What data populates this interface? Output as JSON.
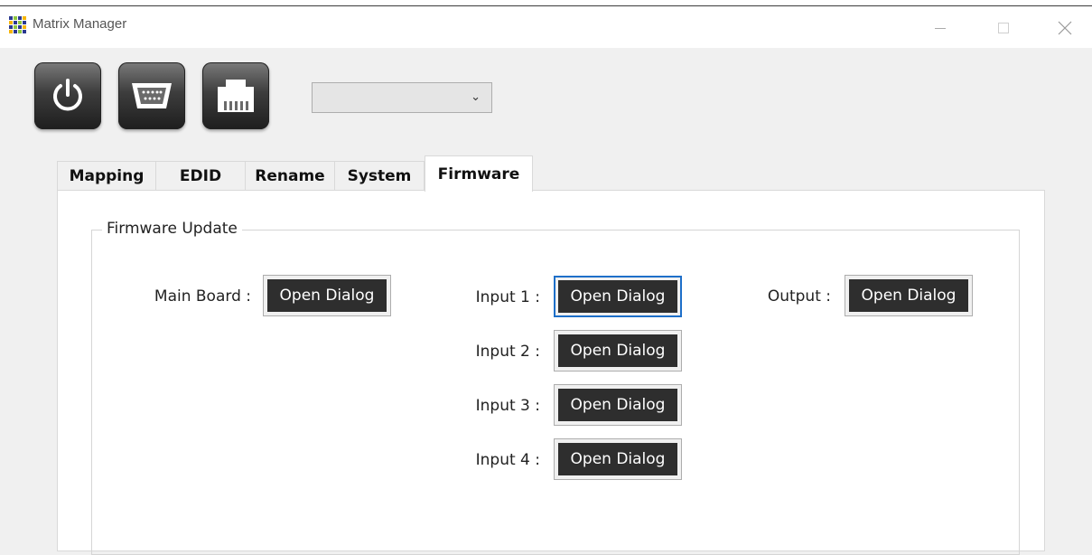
{
  "window": {
    "title": "Matrix Manager",
    "controls": [
      "minimize",
      "maximize",
      "close"
    ]
  },
  "toolbar": {
    "buttons": [
      {
        "icon": "power-icon"
      },
      {
        "icon": "serial-port-icon"
      },
      {
        "icon": "ethernet-port-icon"
      }
    ],
    "port_select": {
      "value": ""
    }
  },
  "tabs": [
    "Mapping",
    "EDID",
    "Rename",
    "System",
    "Firmware"
  ],
  "active_tab": "Firmware",
  "firmware": {
    "group_title": "Firmware Update",
    "main_board": {
      "label": "Main Board :",
      "button": "Open Dialog"
    },
    "inputs": [
      {
        "label": "Input 1 :",
        "button": "Open Dialog"
      },
      {
        "label": "Input 2 :",
        "button": "Open Dialog"
      },
      {
        "label": "Input 3 :",
        "button": "Open Dialog"
      },
      {
        "label": "Input 4 :",
        "button": "Open Dialog"
      }
    ],
    "output": {
      "label": "Output :",
      "button": "Open Dialog"
    }
  },
  "colors": {
    "focus_border": "#1e6fc9",
    "button_fill": "#2e2e2e"
  }
}
